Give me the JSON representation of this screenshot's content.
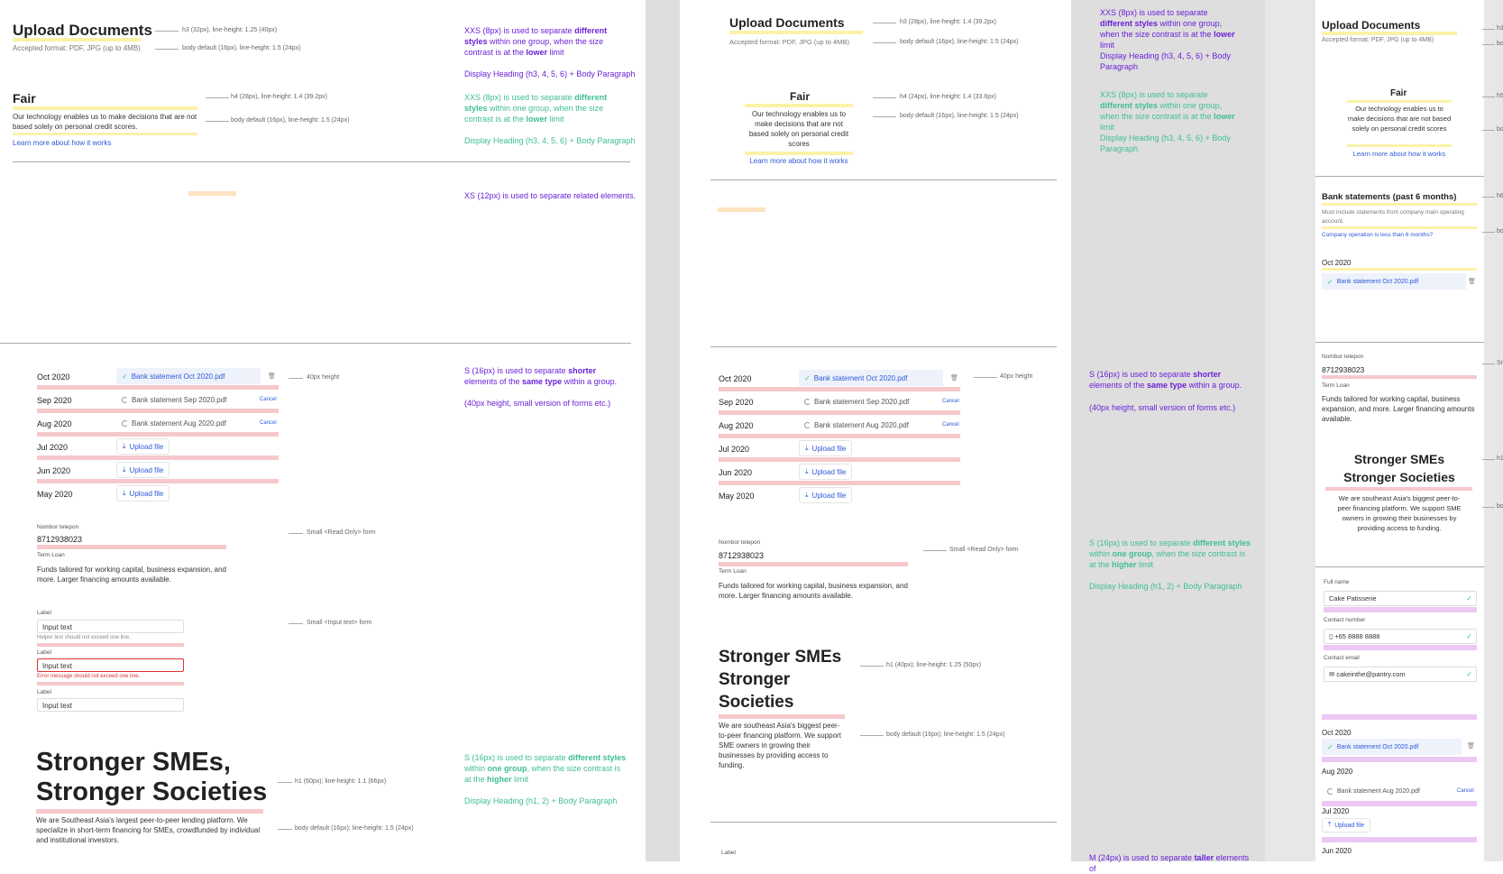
{
  "panel1": {
    "upload": {
      "title": "Upload Documents",
      "sub": "Accepted format: PDF, JPG (up to 4MB)",
      "note_title": "h3 (32px), line-height: 1.25 (40px)",
      "note_sub": "body default (16px), line-height: 1.5 (24px)"
    },
    "fair": {
      "title": "Fair",
      "body": "Our technology enables us to make decisions that are not based solely on personal credit scores.",
      "link": "Learn more about how it works",
      "note_title": "h4 (28px), line-height: 1.4 (39.2px)",
      "note_body": "body default (16px), line-height: 1.5 (24px)"
    },
    "ann1": {
      "pre": "XXS (8px) is used to separate ",
      "bold1": "different styles",
      "mid": " within one group, when the size contrast is at the ",
      "bold2": "lower",
      "post": " limit",
      "foot": "Display Heading (h3, 4, 5, 6) + Body Paragraph"
    },
    "ann2": {
      "pre": "XXS (8px) is used to separate ",
      "bold1": "different styles",
      "mid": " within one group, when the size contrast is at the ",
      "bold2": "lower",
      "post": " limit",
      "foot": "Display Heading (h3, 4, 5, 6) + Body Paragraph"
    },
    "ann3": "XS (12px) is used to separate related elements.",
    "months": [
      {
        "m": "Oct 2020",
        "file": "Bank statement Oct 2020.pdf",
        "state": "done"
      },
      {
        "m": "Sep 2020",
        "file": "Bank statement Sep 2020.pdf",
        "state": "loading"
      },
      {
        "m": "Aug 2020",
        "file": "Bank statement Aug 2020.pdf",
        "state": "loading"
      },
      {
        "m": "Jul 2020",
        "file": "Upload file",
        "state": "upload"
      },
      {
        "m": "Jun 2020",
        "file": "Upload file",
        "state": "upload"
      },
      {
        "m": "May 2020",
        "file": "Upload file",
        "state": "upload"
      }
    ],
    "cancel": "Cancel",
    "note_40": "40px height",
    "ann4": {
      "pre": "S (16px) is used to separate ",
      "bold1": "shorter",
      "mid": " elements of the ",
      "bold2": "same type",
      "post": " within a group.",
      "foot": "(40px height, small version of forms etc.)"
    },
    "readonly": {
      "label": "Nombor telepon",
      "value": "8712938023",
      "label2": "Term Loan",
      "body": "Funds tailored for working capital, business expansion, and more. Larger financing amounts available.",
      "note": "Small <Read Only> form"
    },
    "inputs": {
      "label": "Label",
      "value": "Input text",
      "helper": "Helper text should not exceed one line.",
      "error": "Error message should not exceed one line.",
      "note": "Small <Input text> form"
    },
    "hero": {
      "title1": "Stronger SMEs,",
      "title2": "Stronger Societies",
      "body": "We are Southeast Asia's largest peer-to-peer lending platform. We specialize in short-term financing for SMEs, crowdfunded by individual and institutional investors.",
      "note_title": "h1 (60px); line-height: 1.1 (66px)",
      "note_body": "body default (16px); line-height: 1.5 (24px)"
    },
    "ann5": {
      "pre": "S (16px) is used to separate ",
      "bold1": "different styles",
      "mid": " within ",
      "bold2": "one group",
      "mid2": ", when the size contrast is at the ",
      "bold3": "higher",
      "post": " limit",
      "foot": "Display Heading (h1, 2) + Body Paragraph"
    }
  },
  "panel2": {
    "upload": {
      "title": "Upload Documents",
      "sub": "Accepted format: PDF, JPG (up to 4MB)",
      "note_title": "h3 (28px), line-height: 1.4 (39.2px)",
      "note_sub": "body default (16px), line-height: 1.5 (24px)"
    },
    "fair": {
      "title": "Fair",
      "body": "Our technology enables us to make decisions that are not based solely on personal credit scores",
      "link": "Learn more about how it works",
      "note_title": "h4 (24px), line-height: 1.4 (33.6px)",
      "note_body": "body default (16px), line-height: 1.5 (24px)"
    },
    "ann1": {
      "pre": "XXS (8px) is used to separate ",
      "bold1": "different styles",
      "mid": " within one group, when the size contrast is at the ",
      "bold2": "lower",
      "post": " limit",
      "foot": "Display Heading (h3, 4, 5, 6) + Body Paragraph"
    },
    "ann2": {
      "pre": "XXS (8px) is used to separate ",
      "bold1": "different styles",
      "mid": " within one group, when the size contrast is at the ",
      "bold2": "lower",
      "post": " limit",
      "foot": "Display Heading (h3, 4, 5, 6) + Body Paragraph"
    },
    "note_40": "40px height",
    "ann4": {
      "pre": "S (16px) is used to separate ",
      "bold1": "shorter",
      "mid": " elements of the ",
      "bold2": "same type",
      "post": " within a group.",
      "foot": "(40px height, small version of forms etc.)"
    },
    "readonly": {
      "label": "Nombor telepon",
      "value": "8712938023",
      "label2": "Term Loan",
      "body": "Funds tailored for working capital, business expansion, and more. Larger financing amounts available.",
      "note": "Small <Read Only> form"
    },
    "ann5": {
      "pre": "S (16px) is used to separate ",
      "bold1": "different styles",
      "mid": " within ",
      "bold2": "one group",
      "mid2": ", when the size contrast is at the ",
      "bold3": "higher",
      "post": " limit",
      "foot": "Display Heading (h1, 2) + Body Paragraph"
    },
    "hero": {
      "t1": "Stronger SMEs",
      "t2": "Stronger",
      "t3": "Societies",
      "body": "We are southeast Asia's biggest peer-to-peer financing platform. We support SME owners in growing their businesses by providing access to funding.",
      "note_title": "h1 (40px); line-height: 1.25 (50px)",
      "note_body": "body default (16px); line-height: 1.5 (24px)"
    },
    "bottom_label": "Label",
    "ann6": {
      "pre": "M (24px) is used to separate ",
      "bold1": "taller",
      "post": " elements of"
    }
  },
  "panel3": {
    "upload": {
      "title": "Upload Documents",
      "sub": "Accepted format: PDF, JPG (up to 4MB)"
    },
    "fair": {
      "title": "Fair",
      "body": "Our technology enables us to make decisions that are not based solely on personal credit scores",
      "link": "Learn more about how it works"
    },
    "bank": {
      "title": "Bank statements (past 6 months)",
      "body": "Must include statements from company main operating account.",
      "link": "Company operation is less than 6 months?",
      "month": "Oct 2020",
      "file": "Bank statement Oct 2020.pdf"
    },
    "readonly": {
      "label": "Nombor telepon",
      "value": "8712938023",
      "label2": "Term Loan",
      "body": "Funds tailored for working capital, business expansion, and more. Larger financing amounts available."
    },
    "hero": {
      "t1": "Stronger SMEs",
      "t2": "Stronger Societies",
      "body": "We are southeast Asia's biggest peer-to-peer financing platform. We support SME owners in growing their businesses by providing access to funding."
    },
    "form": {
      "l1": "Full name",
      "v1": "Cake Patisserie",
      "l2": "Contact number",
      "v2": "+65 8888 8888",
      "l3": "Contact email",
      "v3": "cakeinthe@pantry.com"
    },
    "months": [
      {
        "m": "Oct 2020",
        "file": "Bank statement Oct 2020.pdf"
      },
      {
        "m": "Aug 2020",
        "file": "Bank statement Aug 2020.pdf"
      },
      {
        "m": "Jul 2020",
        "file": "Upload file"
      },
      {
        "m": "Jun 2020",
        "file": ""
      }
    ],
    "cancel": "Cancel",
    "edge_notes": [
      "h3",
      "bo",
      "h5",
      "bo",
      "h6",
      "bo",
      "Sm",
      "h1",
      "bo"
    ]
  }
}
